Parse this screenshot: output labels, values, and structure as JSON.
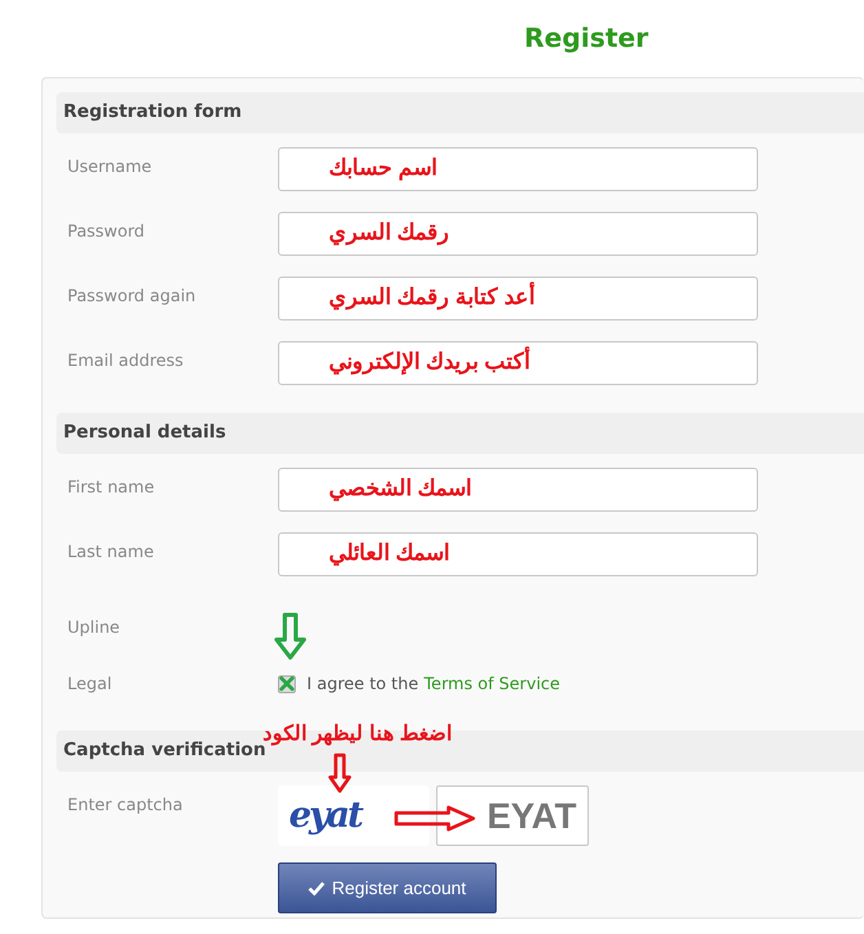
{
  "title": "Register",
  "sections": [
    {
      "heading": "Registration form",
      "rows": [
        {
          "kind": "text",
          "label": "Username",
          "value": "اسم حسابك"
        },
        {
          "kind": "text",
          "label": "Password",
          "value": "رقمك السري"
        },
        {
          "kind": "text",
          "label": "Password again",
          "value": "أعد كتابة رقمك السري"
        },
        {
          "kind": "text",
          "label": "Email address",
          "value": "أكتب بريدك الإلكتروني"
        }
      ]
    },
    {
      "heading": "Personal details",
      "rows": [
        {
          "kind": "text",
          "label": "First name",
          "value": "اسمك الشخصي"
        },
        {
          "kind": "text",
          "label": "Last name",
          "value": "اسمك العائلي"
        },
        {
          "kind": "empty",
          "label": "Upline"
        },
        {
          "kind": "checkbox",
          "label": "Legal",
          "checked": true,
          "text": "I agree to the",
          "link": "Terms of Service"
        }
      ]
    },
    {
      "heading": "Captcha verification",
      "annotation": "اضغط هنا ليظهر الكود",
      "rows": [
        {
          "kind": "captcha",
          "label": "Enter captcha",
          "image_text": "eyat",
          "value": "EYAT"
        }
      ]
    }
  ],
  "button": "Register account"
}
